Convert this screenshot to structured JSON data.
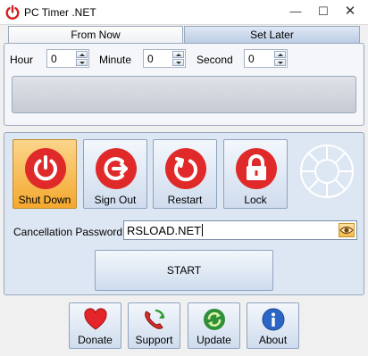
{
  "window": {
    "title": "PC Timer .NET",
    "controls": {
      "minimize": "—",
      "maximize": "☐",
      "close": "✕"
    }
  },
  "tabs": [
    {
      "label": "From Now",
      "active": true
    },
    {
      "label": "Set Later",
      "active": false
    }
  ],
  "time": {
    "hour_label": "Hour",
    "hour_value": "0",
    "minute_label": "Minute",
    "minute_value": "0",
    "second_label": "Second",
    "second_value": "0"
  },
  "actions": [
    {
      "label": "Shut Down",
      "icon": "power-icon",
      "selected": true
    },
    {
      "label": "Sign Out",
      "icon": "sign-out-icon",
      "selected": false
    },
    {
      "label": "Restart",
      "icon": "restart-icon",
      "selected": false
    },
    {
      "label": "Lock",
      "icon": "lock-icon",
      "selected": false
    }
  ],
  "password": {
    "label": "Cancellation Password :",
    "value": "RSLOAD.NET",
    "toggle_icon": "eye-icon"
  },
  "start": {
    "label": "START"
  },
  "bottom_buttons": [
    {
      "label": "Donate",
      "icon": "heart-icon"
    },
    {
      "label": "Support",
      "icon": "phone-icon"
    },
    {
      "label": "Update",
      "icon": "update-icon"
    },
    {
      "label": "About",
      "icon": "info-icon"
    }
  ],
  "colors": {
    "accent_red": "#e02a2a",
    "selected_orange": "#f4a82f",
    "panel_blue": "#dde7f3"
  }
}
